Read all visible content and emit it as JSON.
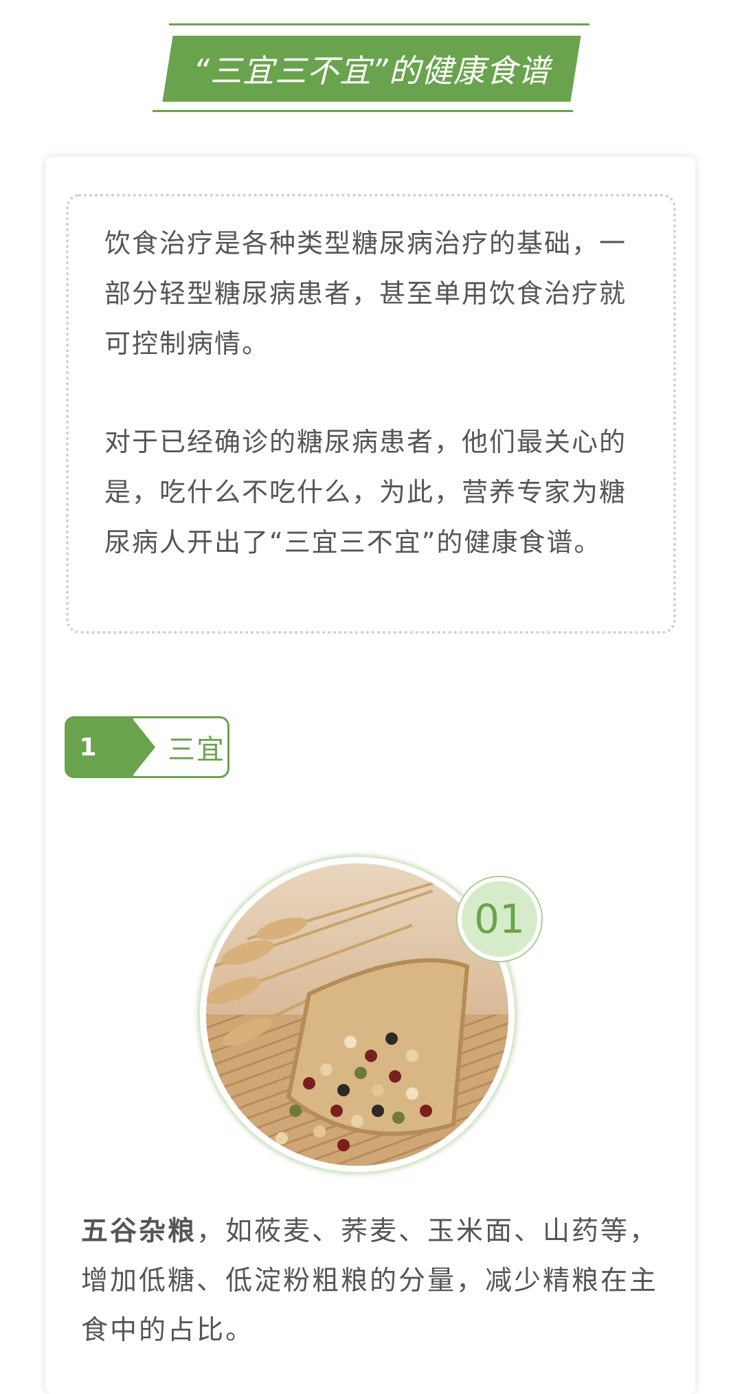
{
  "header": {
    "title": "“三宜三不宜”的健康食谱"
  },
  "intro": {
    "paragraph1": "饮食治疗是各种类型糖尿病治疗的基础，一部分轻型糖尿病患者，甚至单用饮食治疗就可控制病情。",
    "paragraph2": "对于已经确诊的糖尿病患者，他们最关心的是，吃什么不吃什么，为此，营养专家为糖尿病人开出了“三宜三不宜”的健康食谱。"
  },
  "section": {
    "number": "1",
    "label": "三宜"
  },
  "item": {
    "badge": "01",
    "photo_icon": "grains-photo",
    "bold_lead": "五谷杂粮",
    "text": "，如莜麦、荞麦、玉米面、山药等，增加低糖、低淀粉粗粮的分量，减少精粮在主食中的占比。"
  },
  "colors": {
    "accent": "#6aa34d",
    "text": "#555555",
    "badge_bg": "#d6ebc9"
  }
}
